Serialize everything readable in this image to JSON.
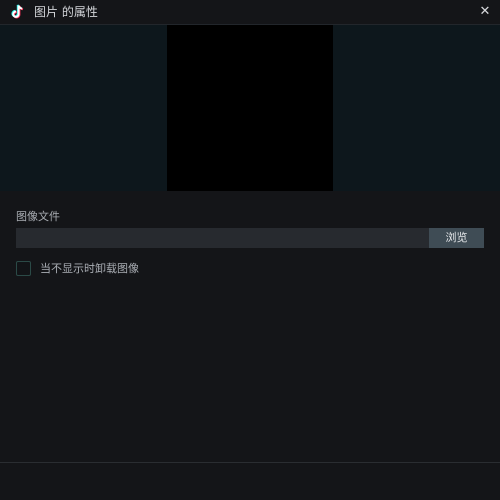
{
  "window": {
    "title": "图片 的属性",
    "app_icon": "tiktok-note-icon",
    "close_label": "✕"
  },
  "preview": {
    "background_color": "#0d171c",
    "image_color": "#000000"
  },
  "image_file": {
    "label": "图像文件",
    "value": "",
    "placeholder": "",
    "browse_label": "浏览"
  },
  "unload_option": {
    "label": "当不显示时卸载图像",
    "checked": false
  },
  "colors": {
    "background": "#141518",
    "accent_cyan": "#25f4ee",
    "accent_pink": "#fe2c55",
    "button": "#3f4c55"
  }
}
